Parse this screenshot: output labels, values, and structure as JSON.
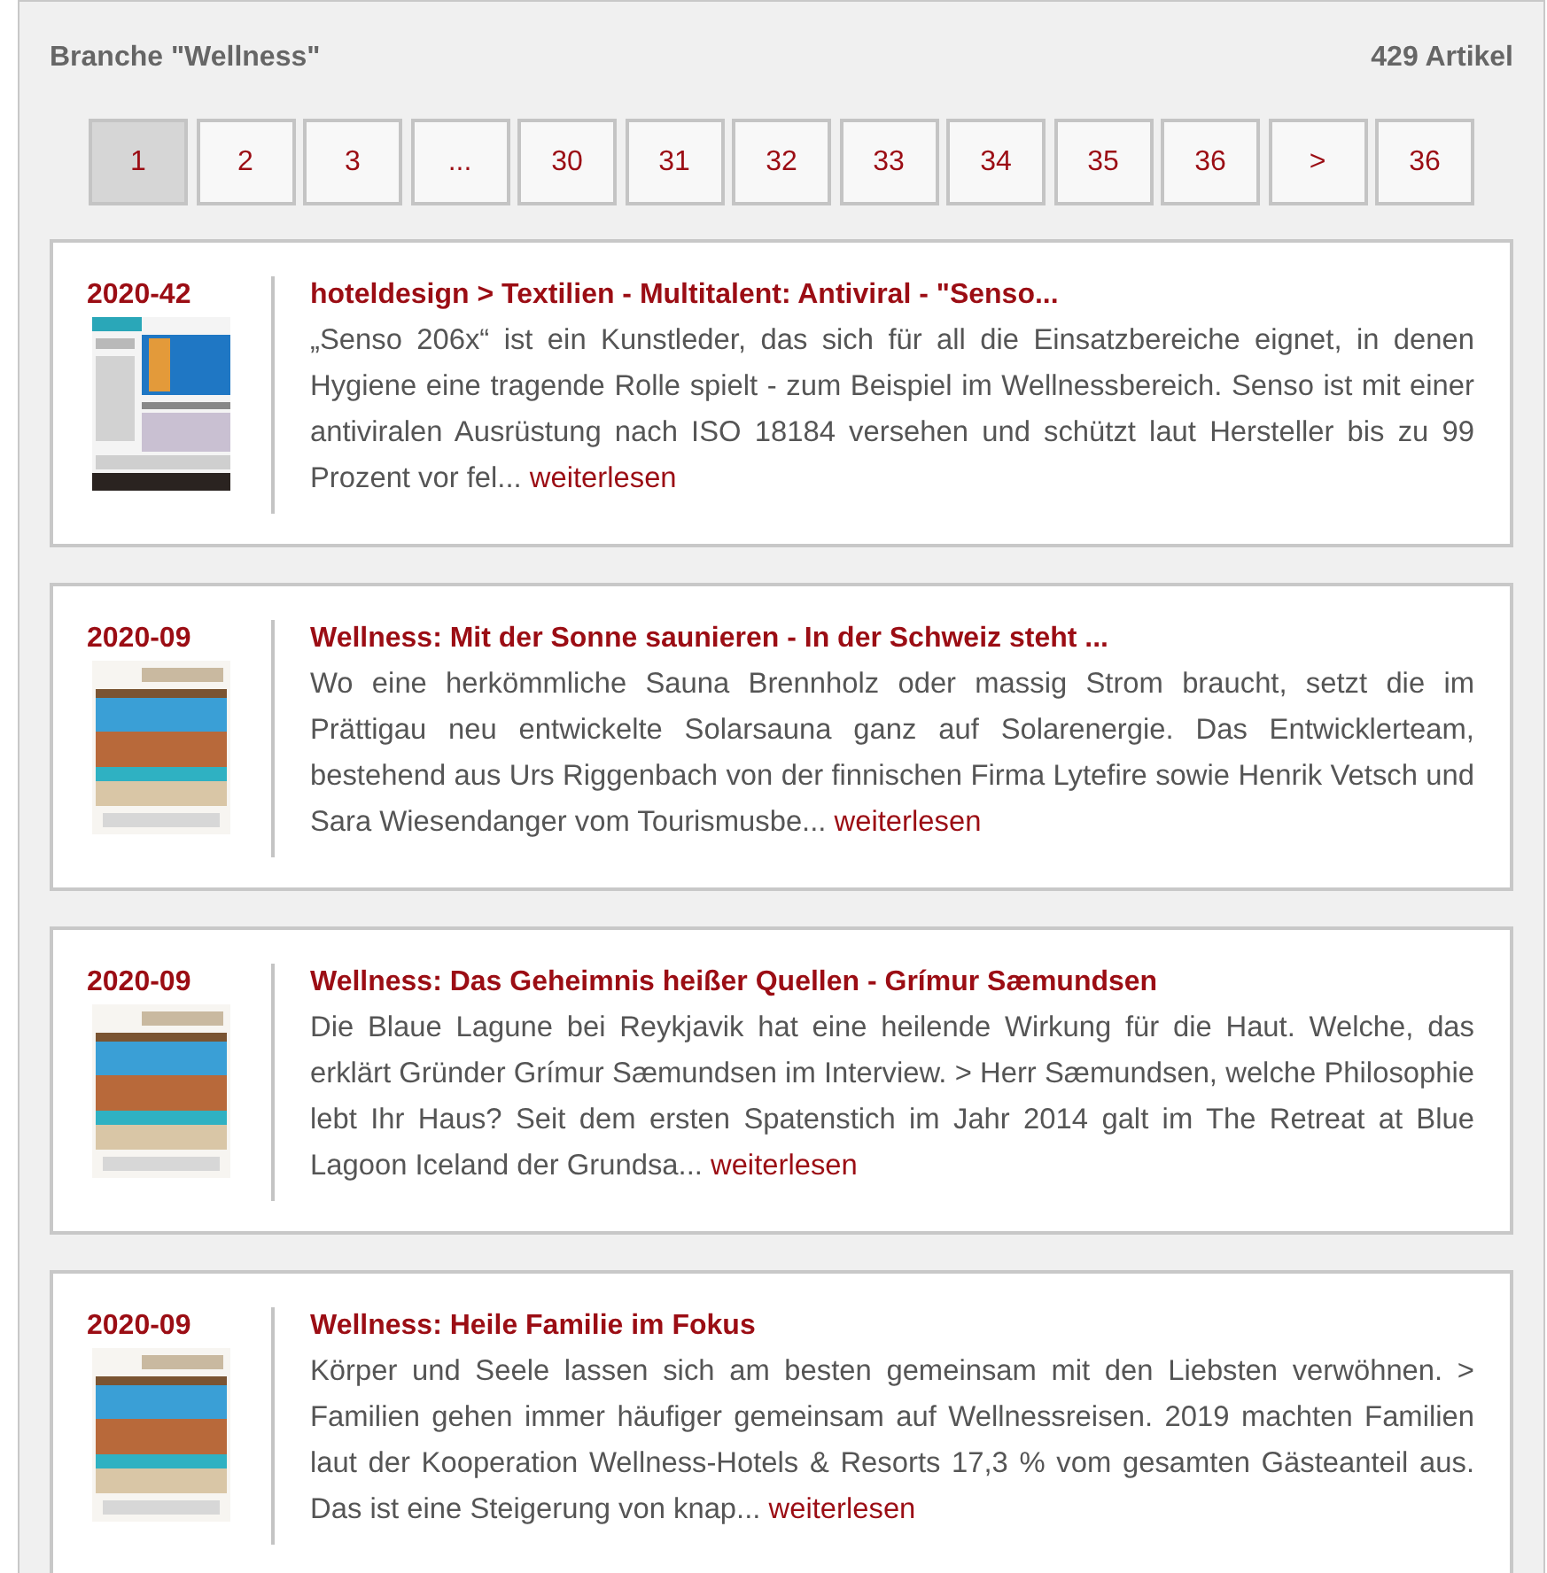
{
  "header": {
    "title": "Branche \"Wellness\"",
    "count": "429 Artikel"
  },
  "pagination": [
    {
      "label": "1",
      "selected": true
    },
    {
      "label": "2",
      "selected": false
    },
    {
      "label": "3",
      "selected": false
    },
    {
      "label": "...",
      "selected": false
    },
    {
      "label": "30",
      "selected": false
    },
    {
      "label": "31",
      "selected": false
    },
    {
      "label": "32",
      "selected": false
    },
    {
      "label": "33",
      "selected": false
    },
    {
      "label": "34",
      "selected": false
    },
    {
      "label": "35",
      "selected": false
    },
    {
      "label": "36",
      "selected": false
    },
    {
      "label": ">",
      "selected": false
    },
    {
      "label": "36",
      "selected": false
    }
  ],
  "articles": [
    {
      "issue": "2020-42",
      "cover": {
        "kind": "newspaper"
      },
      "title": "hoteldesign > Textilien - Multitalent: Antiviral - \"Senso...",
      "excerpt": "„Senso 206x“ ist ein Kunstleder, das sich für all die Einsatzbereiche eignet, in denen Hygiene eine tragende Rolle spielt - zum Beispiel im Wellnessbereich. Senso ist mit einer antiviralen Ausrüstung nach ISO 18184 versehen und schützt laut Hersteller bis zu 99 Prozent vor fel...",
      "link": "weiterlesen"
    },
    {
      "issue": "2020-09",
      "cover": {
        "kind": "magazine"
      },
      "title": "Wellness: Mit der Sonne saunieren - In der Schweiz steht ...",
      "excerpt": "Wo eine herkömmliche Sauna Brennholz oder massig Strom braucht, setzt die im Prättigau neu entwickelte Solarsauna ganz auf Solarenergie. Das Entwicklerteam, bestehend aus Urs Riggenbach von der finnischen Firma Lytefire sowie Henrik Vetsch und Sara Wiesendanger vom Tourismusbe...",
      "link": "weiterlesen"
    },
    {
      "issue": "2020-09",
      "cover": {
        "kind": "magazine"
      },
      "title": "Wellness: Das Geheimnis heißer Quellen - Grímur Sæmundsen",
      "excerpt": "Die Blaue Lagune bei Reykjavik hat eine heilende Wirkung für die Haut. Welche, das erklärt Gründer Grímur Sæmundsen im Interview. > Herr Sæmundsen, welche Philosophie lebt Ihr Haus? Seit dem ersten Spatenstich im Jahr 2014 galt im The Retreat at Blue Lagoon Iceland der Grundsa...",
      "link": "weiterlesen"
    },
    {
      "issue": "2020-09",
      "cover": {
        "kind": "magazine"
      },
      "title": "Wellness: Heile Familie im Fokus",
      "excerpt": "Körper und Seele lassen sich am besten gemeinsam mit den Liebsten verwöhnen. > Familien gehen immer häufiger gemeinsam auf Wellnessreisen. 2019 machten Familien laut der Kooperation Wellness-Hotels & Resorts 17,3 % vom gesamten Gästeanteil aus. Das ist eine Steigerung von knap...",
      "link": "weiterlesen"
    }
  ]
}
